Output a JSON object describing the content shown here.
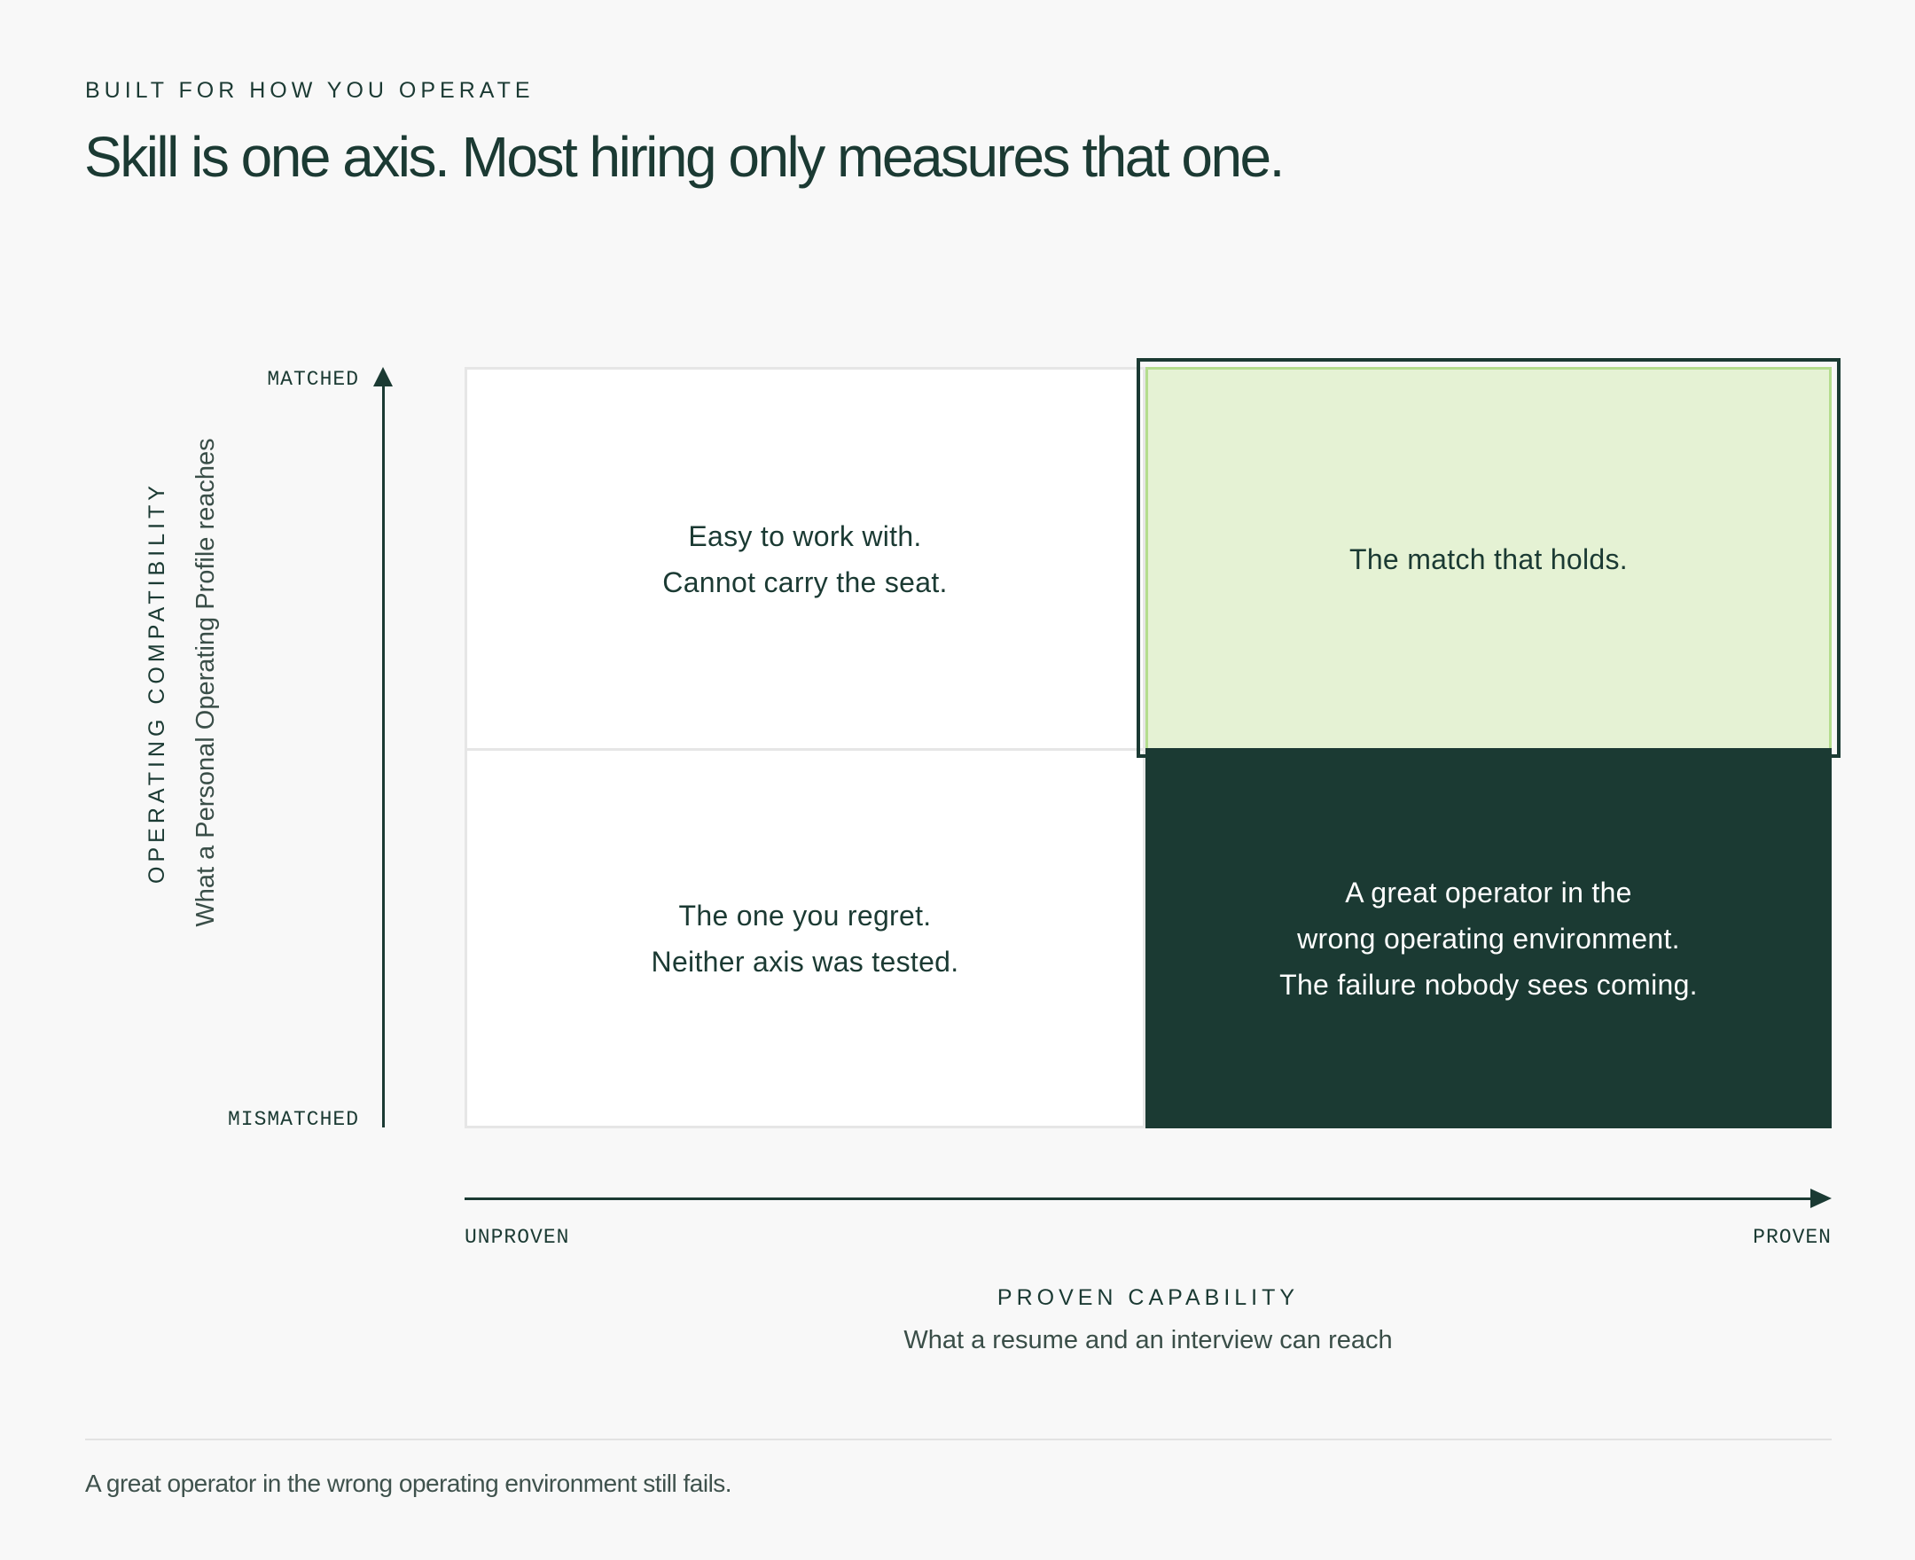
{
  "header": {
    "eyebrow": "BUILT FOR HOW YOU OPERATE",
    "headline": "Skill is one axis. Most hiring only measures that one."
  },
  "y_axis": {
    "top_label": "MATCHED",
    "bottom_label": "MISMATCHED",
    "title": "OPERATING COMPATIBILITY",
    "subtitle": "What a Personal Operating Profile reaches"
  },
  "x_axis": {
    "left_label": "UNPROVEN",
    "right_label": "PROVEN",
    "title": "PROVEN CAPABILITY",
    "subtitle": "What a resume and an interview can reach"
  },
  "quadrants": {
    "top_left": "Easy to work with.\nCannot carry the seat.",
    "top_right": "The match that holds.",
    "bottom_left": "The one you regret.\nNeither axis was tested.",
    "bottom_right": "A great operator in the\nwrong operating environment.\nThe failure nobody sees coming."
  },
  "colors": {
    "ink": "#1b3a33",
    "match_fill": "#e5f2d4",
    "match_border": "#b4dd8e",
    "failure_fill": "#1b3a33"
  },
  "footer": {
    "note": "A great operator in the wrong operating environment still fails."
  }
}
